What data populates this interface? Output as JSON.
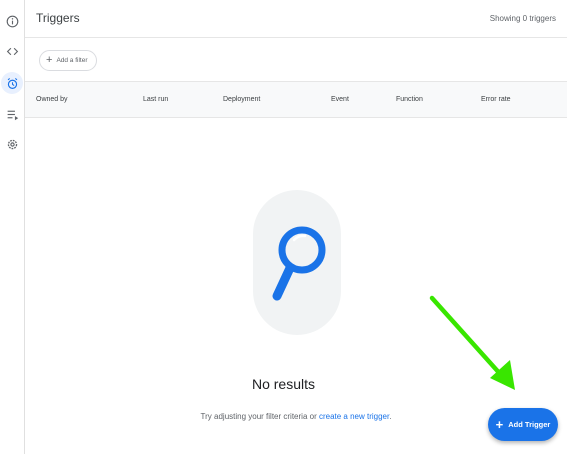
{
  "rail": {
    "items": [
      {
        "icon": "info-icon",
        "active": false
      },
      {
        "icon": "code-icon",
        "active": false
      },
      {
        "icon": "alarm-clock-icon",
        "active": true
      },
      {
        "icon": "executions-list-icon",
        "active": false
      },
      {
        "icon": "settings-icon",
        "active": false
      }
    ]
  },
  "header": {
    "title": "Triggers",
    "count": "Showing 0 triggers"
  },
  "filter": {
    "add_label": "Add a filter"
  },
  "table": {
    "columns": [
      "Owned by",
      "Last run",
      "Deployment",
      "Event",
      "Function",
      "Error rate"
    ]
  },
  "empty": {
    "title": "No results",
    "hint_prefix": "Try adjusting your filter criteria or ",
    "hint_link": "create a new trigger",
    "hint_suffix": "."
  },
  "fab": {
    "label": "Add Trigger"
  },
  "colors": {
    "accent": "#1a73e8",
    "annotation_arrow": "#39e600"
  }
}
